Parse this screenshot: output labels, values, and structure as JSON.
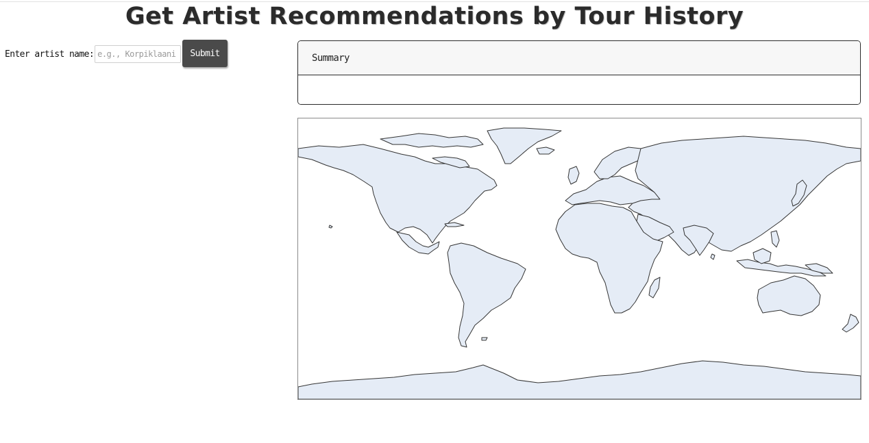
{
  "page": {
    "title": "Get Artist Recommendations by Tour History"
  },
  "form": {
    "label": "Enter artist name:",
    "input_value": "",
    "input_placeholder": "e.g., Korpiklaani",
    "submit_label": "Submit"
  },
  "summary": {
    "header": "Summary",
    "body": ""
  },
  "map": {
    "projection": "equirectangular",
    "land_color": "#e5ecf6",
    "border_color": "#333333",
    "ocean_color": "#ffffff"
  }
}
